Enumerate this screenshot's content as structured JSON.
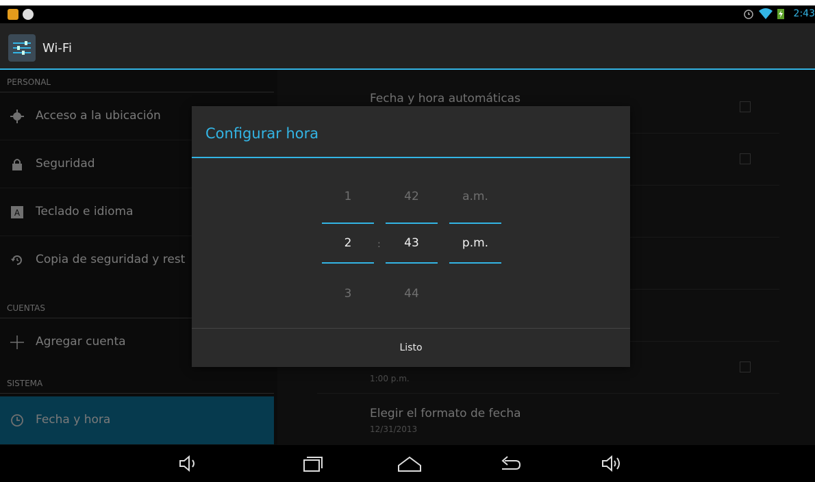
{
  "status_bar": {
    "time": "2:43"
  },
  "action_bar": {
    "title": "Wi-Fi"
  },
  "sidebar": {
    "headers": [
      "PERSONAL",
      "CUENTAS",
      "SISTEMA"
    ],
    "items": [
      {
        "label": "Acceso a la ubicación",
        "icon": "location-icon"
      },
      {
        "label": "Seguridad",
        "icon": "lock-icon"
      },
      {
        "label": "Teclado e idioma",
        "icon": "keyboard-icon"
      },
      {
        "label": "Copia de seguridad y rest",
        "icon": "backup-icon"
      },
      {
        "label": "Agregar cuenta",
        "icon": "plus-icon"
      },
      {
        "label": "Fecha y hora",
        "icon": "clock-icon"
      }
    ]
  },
  "right": {
    "rows": [
      {
        "title": "Fecha y hora automáticas",
        "subtitle": ""
      },
      {
        "title": "",
        "subtitle": "1:00 p.m."
      },
      {
        "title": "Elegir el formato de fecha",
        "subtitle": "12/31/2013"
      }
    ]
  },
  "dialog": {
    "title": "Configurar hora",
    "hour": {
      "prev": "1",
      "value": "2",
      "next": "3"
    },
    "minute": {
      "prev": "42",
      "value": "43",
      "next": "44"
    },
    "ampm": {
      "prev": "a.m.",
      "value": "p.m."
    },
    "separator": ":",
    "done_label": "Listo"
  },
  "colors": {
    "accent": "#33b5e5",
    "selected_bg": "#0b6a8f"
  }
}
